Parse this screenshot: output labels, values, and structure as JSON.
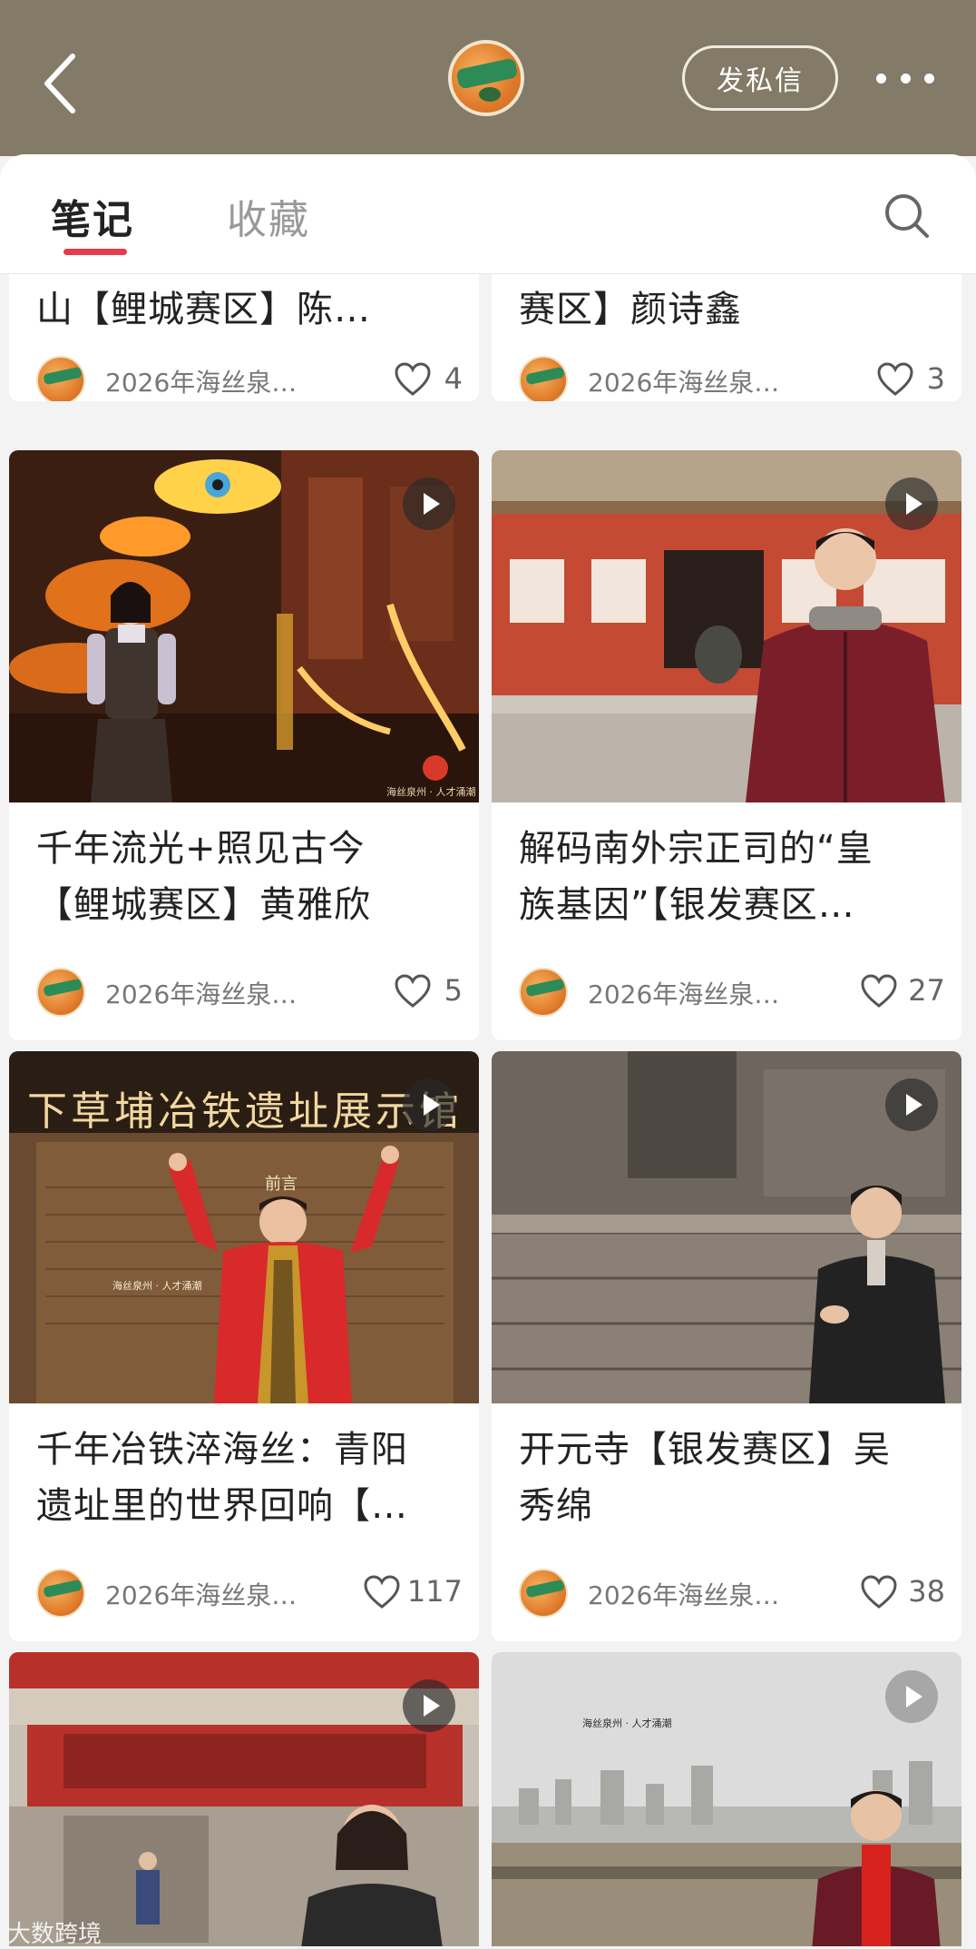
{
  "header": {
    "back_label": "back",
    "message_button": "发私信",
    "more_label": "more"
  },
  "tabs": [
    {
      "label": "笔记",
      "active": true
    },
    {
      "label": "收藏",
      "active": false
    }
  ],
  "cards": [
    {
      "title_line1": "山【鲤城赛区】陈…",
      "title_line2": "",
      "author": "2026年海丝泉…",
      "likes": "4"
    },
    {
      "title_line1": "赛区】颜诗鑫",
      "title_line2": "",
      "author": "2026年海丝泉…",
      "likes": "3"
    },
    {
      "title_line1": "千年流光+照见古今",
      "title_line2": "【鲤城赛区】黄雅欣",
      "author": "2026年海丝泉…",
      "likes": "5"
    },
    {
      "title_line1": "解码南外宗正司的“皇",
      "title_line2": "族基因”【银发赛区…",
      "author": "2026年海丝泉…",
      "likes": "27"
    },
    {
      "title_line1": "千年冶铁淬海丝：青阳",
      "title_line2": "遗址里的世界回响【…",
      "author": "2026年海丝泉…",
      "likes": "117"
    },
    {
      "title_line1": "开元寺【银发赛区】吴",
      "title_line2": "秀绵",
      "author": "2026年海丝泉…",
      "likes": "38"
    }
  ],
  "thumb_text": {
    "museum_sign": "下草埔冶铁遗址展示馆",
    "preface": "前言",
    "slogan": "海丝泉州 · 人才涌潮",
    "watermark": "大数跨境"
  },
  "colors": {
    "header_bg": "#837b68",
    "tab_accent": "#e53b4e"
  }
}
